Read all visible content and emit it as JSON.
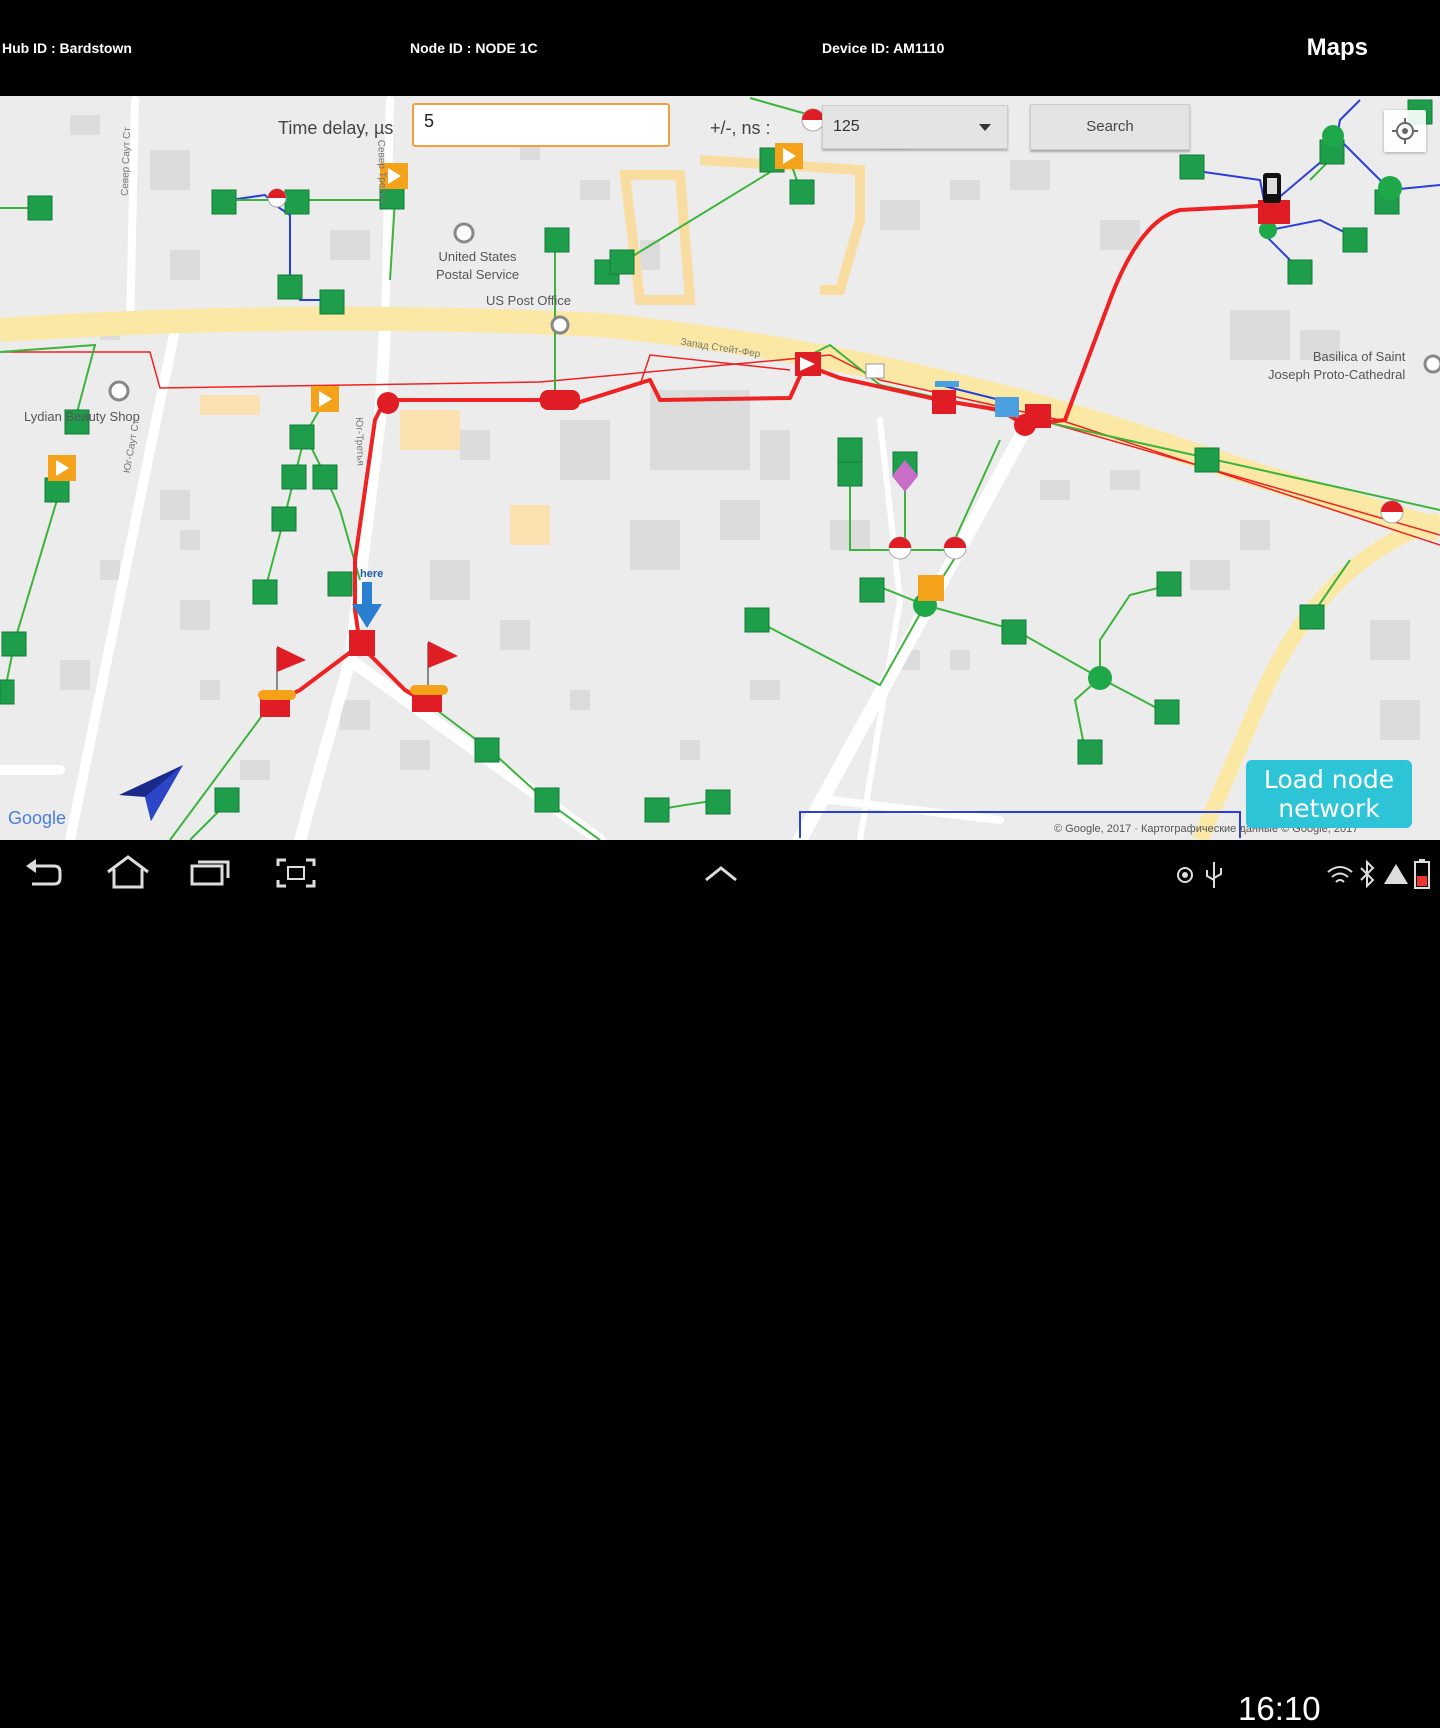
{
  "header": {
    "hub_id": "Hub ID : Bardstown",
    "node_id": "Node ID : NODE 1C",
    "device_id": "Device ID: AM1110",
    "title": "Maps"
  },
  "controls": {
    "delay_label": "Time delay, µs",
    "delay_value": "5",
    "plusminus_label": "+/-, ns :",
    "ns_selected": "125",
    "search_label": "Search"
  },
  "map": {
    "places": {
      "post_service": "United States\nPostal Service",
      "post_office": "US Post Office",
      "basilica": "Basilica of Saint\nJoseph Proto-Cathedral",
      "lydian": "Lydian Beauty Shop"
    },
    "streets": {
      "main": "Запад Стейт-Фер",
      "s1": "Север Саут Ст",
      "s2": "Север Третья",
      "s3": "Юг-Третья",
      "s4": "Юг-Саут Ст"
    },
    "you_here": "here",
    "google": "Google",
    "copyright": "© Google, 2017 · Картографические данные © Google, 2017",
    "load_button": "Load node\nnetwork"
  },
  "status": {
    "time": "16:10"
  },
  "colors": {
    "route_red": "#ee2222",
    "link_green": "#3cb43c",
    "link_blue": "#2b3fd8",
    "road_yellow": "#fbe8a4",
    "node_green": "#1e9e4a",
    "accent_cyan": "#2ec4d8"
  },
  "icons": [
    "back-icon",
    "home-icon",
    "recent-apps-icon",
    "screenshot-icon",
    "chevron-up-icon",
    "location-icon",
    "usb-icon",
    "wifi-icon",
    "bluetooth-icon",
    "battery-icon",
    "my-location-icon",
    "navigation-arrow-icon"
  ]
}
